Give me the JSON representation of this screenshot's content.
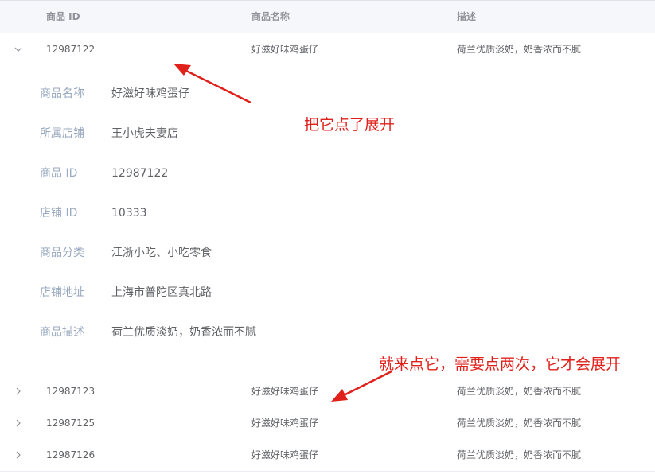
{
  "table": {
    "columns": {
      "id": "商品 ID",
      "name": "商品名称",
      "desc": "描述"
    },
    "rows": [
      {
        "id": "12987122",
        "name": "好滋好味鸡蛋仔",
        "desc": "荷兰优质淡奶，奶香浓而不腻",
        "expanded": true
      },
      {
        "id": "12987123",
        "name": "好滋好味鸡蛋仔",
        "desc": "荷兰优质淡奶，奶香浓而不腻",
        "expanded": false
      },
      {
        "id": "12987125",
        "name": "好滋好味鸡蛋仔",
        "desc": "荷兰优质淡奶，奶香浓而不腻",
        "expanded": false
      },
      {
        "id": "12987126",
        "name": "好滋好味鸡蛋仔",
        "desc": "荷兰优质淡奶，奶香浓而不腻",
        "expanded": false
      }
    ]
  },
  "detail": {
    "items": [
      {
        "label": "商品名称",
        "value": "好滋好味鸡蛋仔"
      },
      {
        "label": "所属店铺",
        "value": "王小虎夫妻店"
      },
      {
        "label": "商品 ID",
        "value": "12987122"
      },
      {
        "label": "店铺 ID",
        "value": "10333"
      },
      {
        "label": "商品分类",
        "value": "江浙小吃、小吃零食"
      },
      {
        "label": "店铺地址",
        "value": "上海市普陀区真北路"
      },
      {
        "label": "商品描述",
        "value": "荷兰优质淡奶，奶香浓而不腻"
      }
    ]
  },
  "annotations": {
    "first": "把它点了展开",
    "second": "就来点它，需要点两次，它才会展开"
  },
  "colors": {
    "annotation": "#e0211b",
    "label": "#99a9bf",
    "text": "#606266",
    "header_bg": "#f6f7fa"
  },
  "icons": {
    "expanded": "chevron-down-icon",
    "collapsed": "chevron-right-icon"
  }
}
